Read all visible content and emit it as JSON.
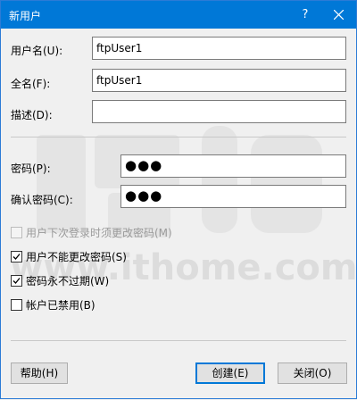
{
  "titlebar": {
    "title": "新用户",
    "help_glyph": "?"
  },
  "form": {
    "username": {
      "label": "用户名(U):",
      "value": "ftpUser1"
    },
    "fullname": {
      "label": "全名(F):",
      "value": "ftpUser1"
    },
    "description": {
      "label": "描述(D):",
      "value": ""
    },
    "password": {
      "label": "密码(P):",
      "value": "●●●"
    },
    "confirm_password": {
      "label": "确认密码(C):",
      "value": "●●●"
    }
  },
  "options": [
    {
      "label": "用户下次登录时须更改密码(M)",
      "checked": false,
      "disabled": true
    },
    {
      "label": "用户不能更改密码(S)",
      "checked": true,
      "disabled": false
    },
    {
      "label": "密码永不过期(W)",
      "checked": true,
      "disabled": false
    },
    {
      "label": "帐户已禁用(B)",
      "checked": false,
      "disabled": false
    }
  ],
  "buttons": {
    "help": "帮助(H)",
    "create": "创建(E)",
    "close": "关闭(O)"
  },
  "watermark": {
    "text": "www.ithome.com",
    "color": "#d9d9d9"
  },
  "colors": {
    "titlebar": "#0078d7",
    "default_button_border": "#0078d7"
  }
}
